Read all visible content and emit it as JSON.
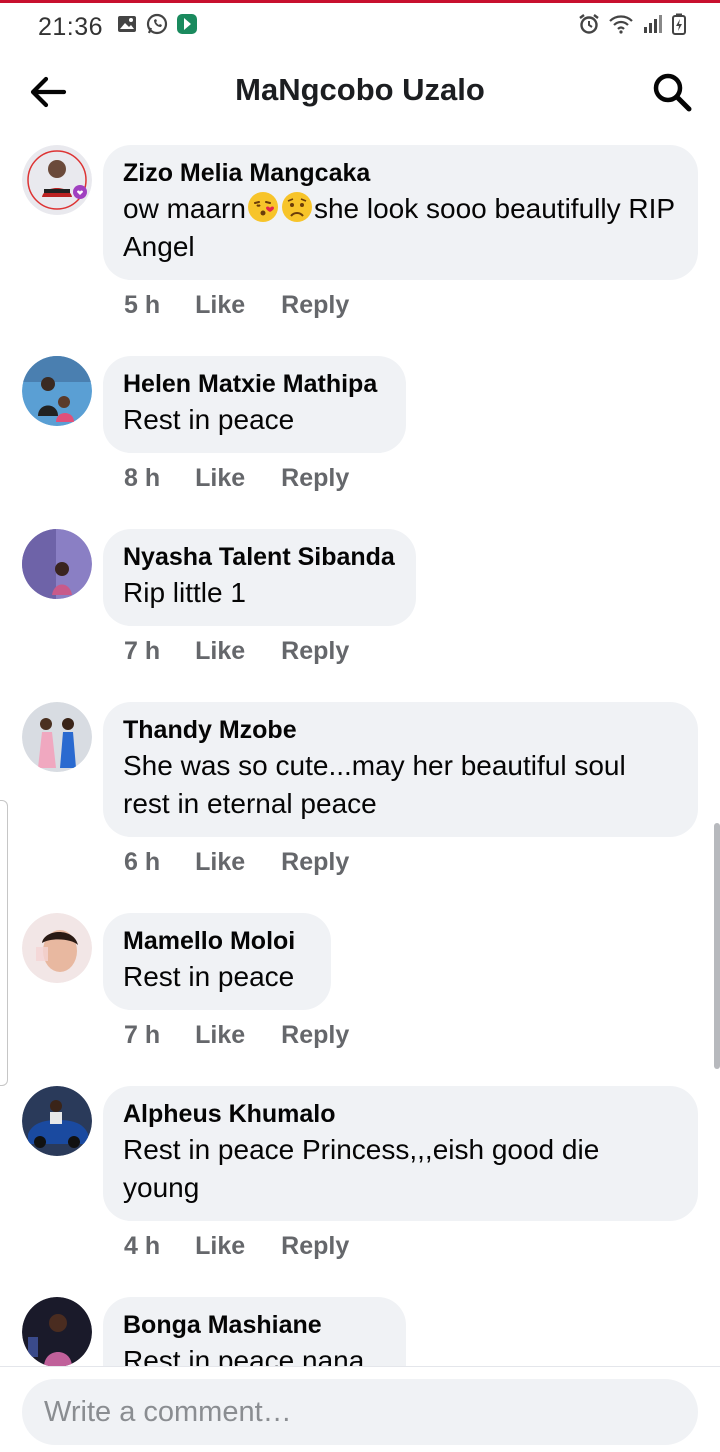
{
  "status_bar": {
    "time": "21:36",
    "left_icons": [
      "gallery-icon",
      "whatsapp-icon",
      "app-icon"
    ],
    "right_icons": [
      "alarm-icon",
      "wifi-icon",
      "signal-icon",
      "battery-icon"
    ]
  },
  "header": {
    "title": "MaNgcobo Uzalo"
  },
  "comments": [
    {
      "author": "Zizo Melia Mangcaka",
      "text_before": "ow maarn",
      "text_after": "she look sooo beautifully RIP Angel",
      "emojis": [
        "kiss-emoji",
        "sad-emoji"
      ],
      "time": "5 h",
      "like": "Like",
      "reply": "Reply"
    },
    {
      "author": "Helen Matxie Mathipa",
      "text": "Rest in peace",
      "time": "8 h",
      "like": "Like",
      "reply": "Reply"
    },
    {
      "author": "Nyasha Talent Sibanda",
      "text": "Rip little 1",
      "time": "7 h",
      "like": "Like",
      "reply": "Reply"
    },
    {
      "author": "Thandy Mzobe",
      "text": "She was so cute...may her beautiful soul rest in eternal peace",
      "time": "6 h",
      "like": "Like",
      "reply": "Reply"
    },
    {
      "author": "Mamello Moloi",
      "text": "Rest in peace",
      "time": "7 h",
      "like": "Like",
      "reply": "Reply"
    },
    {
      "author": "Alpheus Khumalo",
      "text": "Rest in peace Princess,,,eish good die young",
      "time": "4 h",
      "like": "Like",
      "reply": "Reply"
    },
    {
      "author": "Bonga Mashiane",
      "text": "Rest in peace nana"
    }
  ],
  "footer": {
    "placeholder": "Write a comment…"
  },
  "colors": {
    "bubble": "#f0f2f5",
    "meta_text": "#65676b",
    "top_accent": "#c8102e"
  }
}
